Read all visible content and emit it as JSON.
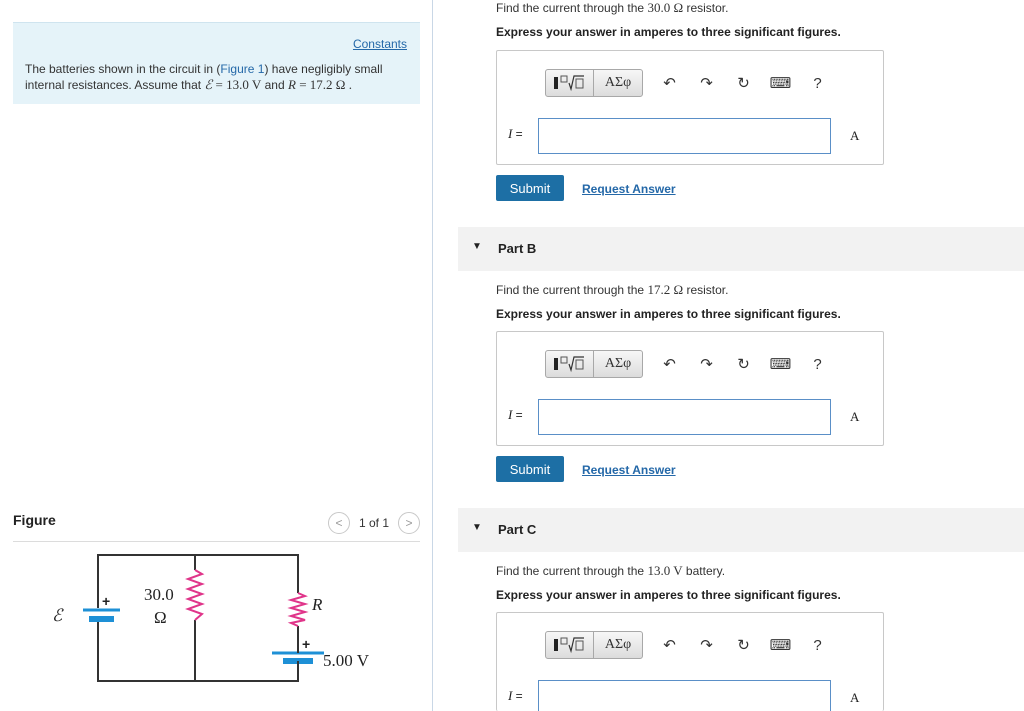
{
  "left": {
    "constants_link": "Constants",
    "problem": {
      "pre": "The batteries shown in the circuit in (",
      "figure_link": "Figure 1",
      "mid": ") have negligibly small internal resistances. Assume that ",
      "emf_symbol": "ℰ",
      "emf_value": " = 13.0 V",
      "and": " and ",
      "r_symbol": "R",
      "r_value": " = 17.2 Ω ."
    },
    "figure": {
      "title": "Figure",
      "pager_text": "1 of 1",
      "prev": "<",
      "next": ">",
      "labels": {
        "emf": "ℰ",
        "resistor_value": "30.0",
        "resistor_unit": "Ω",
        "r_label": "R",
        "battery_value": "5.00 V",
        "plus": "+"
      }
    }
  },
  "toolbar": {
    "greek": "ΑΣφ",
    "help": "?"
  },
  "partA": {
    "question_pre": "Find the current through the ",
    "question_value": "30.0 Ω",
    "question_post": " resistor.",
    "instruction": "Express your answer in amperes to three significant figures.",
    "var_label": "I",
    "eq": " =",
    "input_value": "",
    "unit": "A",
    "submit": "Submit",
    "request": "Request Answer"
  },
  "partB": {
    "header": "Part B",
    "question_pre": "Find the current through the ",
    "question_value": "17.2 Ω",
    "question_post": " resistor.",
    "instruction": "Express your answer in amperes to three significant figures.",
    "var_label": "I",
    "eq": " =",
    "input_value": "",
    "unit": "A",
    "submit": "Submit",
    "request": "Request Answer"
  },
  "partC": {
    "header": "Part C",
    "question_pre": "Find the current through the ",
    "question_value": "13.0 V",
    "question_post": " battery.",
    "instruction": "Express your answer in amperes to three significant figures.",
    "var_label": "I",
    "eq": " =",
    "input_value": "",
    "unit": "A"
  },
  "colors": {
    "link": "#2468a8",
    "submit_bg": "#1d6fa5",
    "problem_bg": "#e5f3f9",
    "resistor": "#e0358a",
    "battery": "#1e90d6"
  }
}
